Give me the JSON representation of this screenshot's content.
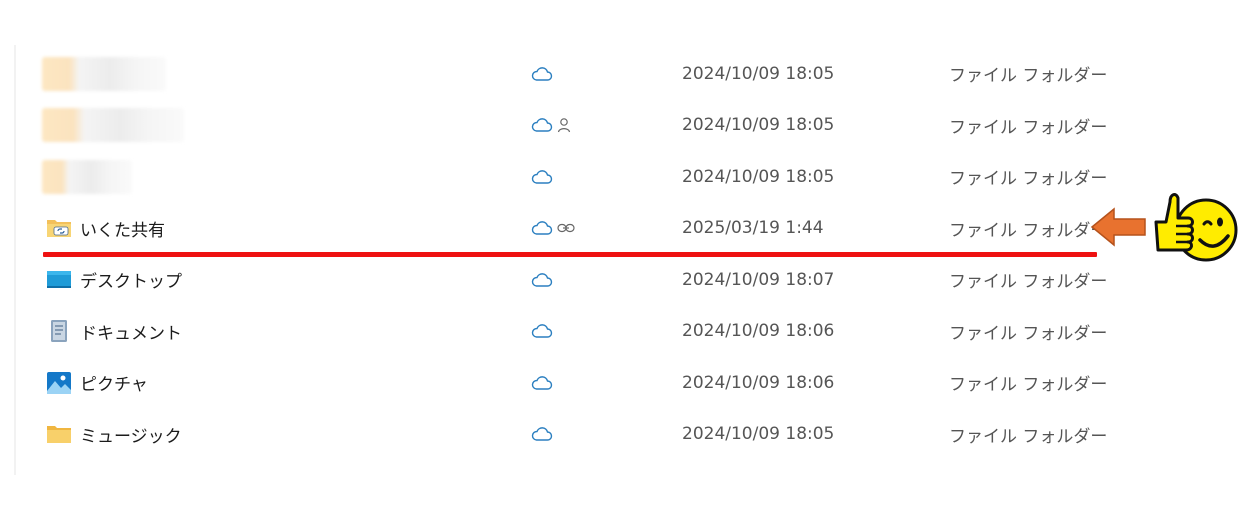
{
  "colors": {
    "cloud": "#2b7fc0",
    "text_primary": "#1b1b1b",
    "text_secondary": "#555555",
    "highlight_line": "#ee1111",
    "arrow": "#e8722f",
    "smiley": "#ffec00"
  },
  "rows": [
    {
      "name": "",
      "blurred": true,
      "icon": "blurred-folder-icon",
      "status": [
        "cloud-icon"
      ],
      "modified": "2024/10/09 18:05",
      "type": "ファイル フォルダー"
    },
    {
      "name": "",
      "blurred": true,
      "icon": "blurred-folder-icon",
      "status": [
        "cloud-icon",
        "person-icon"
      ],
      "modified": "2024/10/09 18:05",
      "type": "ファイル フォルダー"
    },
    {
      "name": "",
      "blurred": true,
      "icon": "blurred-folder-icon",
      "status": [
        "cloud-icon"
      ],
      "modified": "2024/10/09 18:05",
      "type": "ファイル フォルダー"
    },
    {
      "name": "いくた共有",
      "blurred": false,
      "icon": "shared-folder-icon",
      "status": [
        "cloud-icon",
        "link-icon"
      ],
      "modified": "2025/03/19 1:44",
      "type": "ファイル フォルダー"
    },
    {
      "name": "デスクトップ",
      "blurred": false,
      "icon": "desktop-icon",
      "status": [
        "cloud-icon"
      ],
      "modified": "2024/10/09 18:07",
      "type": "ファイル フォルダー"
    },
    {
      "name": "ドキュメント",
      "blurred": false,
      "icon": "document-icon",
      "status": [
        "cloud-icon"
      ],
      "modified": "2024/10/09 18:06",
      "type": "ファイル フォルダー"
    },
    {
      "name": "ピクチャ",
      "blurred": false,
      "icon": "picture-icon",
      "status": [
        "cloud-icon"
      ],
      "modified": "2024/10/09 18:06",
      "type": "ファイル フォルダー"
    },
    {
      "name": "ミュージック",
      "blurred": false,
      "icon": "music-folder-icon",
      "status": [
        "cloud-icon"
      ],
      "modified": "2024/10/09 18:05",
      "type": "ファイル フォルダー"
    }
  ],
  "annotations": {
    "highlighted_row": "いくた共有",
    "arrow_icon": "left-arrow-icon",
    "thumbs_icon": "thumbs-up-smiley-icon"
  }
}
